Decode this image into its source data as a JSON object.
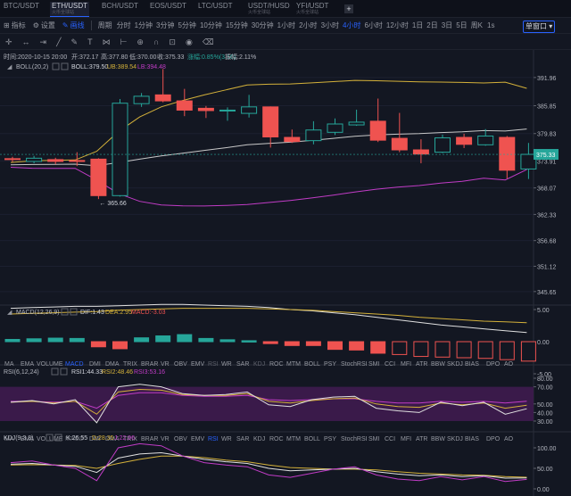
{
  "tabs": [
    {
      "pair": "BTC/USDT",
      "sub": "",
      "active": false
    },
    {
      "pair": "ETH/USDT",
      "sub": "火币全球站",
      "active": true
    },
    {
      "pair": "BCH/USDT",
      "sub": "",
      "active": false
    },
    {
      "pair": "EOS/USDT",
      "sub": "",
      "active": false
    },
    {
      "pair": "LTC/USDT",
      "sub": "",
      "active": false
    },
    {
      "pair": "USDT/HUSD",
      "sub": "火币全球站",
      "active": false
    },
    {
      "pair": "YFI/USDT",
      "sub": "火币全球站",
      "active": false
    }
  ],
  "tab_add": "+",
  "toolbar": {
    "indicator": "指标",
    "settings": "设置",
    "draw": "画线",
    "period_label": "周期",
    "periods": [
      "分时",
      "1分钟",
      "3分钟",
      "5分钟",
      "10分钟",
      "15分钟",
      "30分钟",
      "1小时",
      "2小时",
      "3小时",
      "4小时",
      "6小时",
      "12小时",
      "1日",
      "2日",
      "3日",
      "5日",
      "周K"
    ],
    "active_period": "4小时",
    "right1": "1s",
    "right2": "单窗口"
  },
  "drawing_tools": [
    "cursor-icon",
    "horizontal-line-icon",
    "ray-icon",
    "trend-line-icon",
    "pen-icon",
    "text-icon",
    "pattern-icon",
    "ruler-icon",
    "zoom-in-icon",
    "magnet-icon",
    "lock-icon",
    "eye-icon",
    "trash-icon"
  ],
  "ohlc": {
    "time": "时间:2020-10-15 20:00",
    "open": "开:372.17",
    "high": "高:377.80",
    "low": "低:370.00",
    "close": "收:375.33",
    "change": "涨幅:0.85%(3.16)",
    "amplitude": "振幅:2.11%"
  },
  "boll": {
    "label": "BOLL(20,2)",
    "mid": "BOLL:379.50",
    "ub": "UB:389.54",
    "lb": "LB:394.48"
  },
  "price_axis": [
    "391.96",
    "385.85",
    "379.83",
    "373.91",
    "368.07",
    "362.33",
    "356.68",
    "351.12",
    "345.65"
  ],
  "current_price": "375.33",
  "low_label": "← 365.66",
  "candles": [
    {
      "o": 374.4,
      "c": 374.2,
      "h": 374.8,
      "l": 373.7
    },
    {
      "o": 373.8,
      "c": 374.5,
      "h": 375.0,
      "l": 373.4
    },
    {
      "o": 374.2,
      "c": 373.8,
      "h": 374.6,
      "l": 373.2
    },
    {
      "o": 374.0,
      "c": 373.8,
      "h": 375.8,
      "l": 372.8
    },
    {
      "o": 374.3,
      "c": 366.4,
      "h": 374.5,
      "l": 365.66
    },
    {
      "o": 366.4,
      "c": 386.4,
      "h": 387.3,
      "l": 366.2
    },
    {
      "o": 386.3,
      "c": 387.9,
      "h": 388.6,
      "l": 385.6
    },
    {
      "o": 388.2,
      "c": 386.9,
      "h": 393.8,
      "l": 386.6
    },
    {
      "o": 386.9,
      "c": 384.9,
      "h": 389.5,
      "l": 383.6
    },
    {
      "o": 385.3,
      "c": 384.8,
      "h": 385.8,
      "l": 383.2
    },
    {
      "o": 384.8,
      "c": 384.9,
      "h": 385.5,
      "l": 382.6
    },
    {
      "o": 384.2,
      "c": 385.6,
      "h": 388.2,
      "l": 383.3
    },
    {
      "o": 385.6,
      "c": 379.1,
      "h": 385.7,
      "l": 376.8
    },
    {
      "o": 379.0,
      "c": 378.1,
      "h": 380.7,
      "l": 377.8
    },
    {
      "o": 378.3,
      "c": 380.6,
      "h": 382.5,
      "l": 377.5
    },
    {
      "o": 380.1,
      "c": 381.9,
      "h": 383.1,
      "l": 379.5
    },
    {
      "o": 381.7,
      "c": 382.3,
      "h": 385.0,
      "l": 381.5
    },
    {
      "o": 382.5,
      "c": 378.4,
      "h": 387.4,
      "l": 378.0
    },
    {
      "o": 378.8,
      "c": 376.3,
      "h": 384.3,
      "l": 375.8
    },
    {
      "o": 376.3,
      "c": 375.4,
      "h": 378.6,
      "l": 373.4
    },
    {
      "o": 375.8,
      "c": 378.9,
      "h": 379.6,
      "l": 375.6
    },
    {
      "o": 379.0,
      "c": 377.5,
      "h": 379.8,
      "l": 376.7
    },
    {
      "o": 377.4,
      "c": 379.3,
      "h": 380.8,
      "l": 377.2
    },
    {
      "o": 379.0,
      "c": 371.9,
      "h": 379.3,
      "l": 370.1
    },
    {
      "o": 372.17,
      "c": 375.33,
      "h": 377.8,
      "l": 370.0
    }
  ],
  "macd": {
    "label": "MACD(12,26,9)",
    "dif": "DIF:1.43",
    "dea": "DEA:2.95",
    "macd": "MACD:-3.03",
    "axis": [
      "5.00",
      "0.00",
      "-5.00"
    ],
    "hist": [
      0.35,
      0.45,
      0.55,
      0.5,
      -0.8,
      -1.1,
      0.6,
      0.9,
      1.1,
      0.5,
      0.3,
      0.15,
      -0.3,
      -0.6,
      -0.6,
      -1.2,
      -1.3,
      -1.8,
      -2.0,
      -2.3,
      -2.4,
      -2.5,
      -2.6,
      -2.8,
      -3.03
    ]
  },
  "rsi": {
    "label": "RSI(6,12,24)",
    "r1": "RSI1:44.33",
    "r2": "RSI2:48.46",
    "r3": "RSI3:53.16",
    "axis": [
      "80.00",
      "70.00",
      "50.00",
      "40.00",
      "30.00"
    ]
  },
  "kdj": {
    "label": "KDJ(9,3,3)",
    "k": "K:26.55",
    "d": "D:28.35",
    "j": "J:22.96",
    "axis": [
      "100.00",
      "50.00",
      "0.00"
    ]
  },
  "indicator_bar": [
    "MA",
    "EMA",
    "VOLUME",
    "MACD",
    "DMI",
    "DMA",
    "TRIX",
    "BRAR",
    "VR",
    "OBV",
    "EMV",
    "RSI",
    "WR",
    "SAR",
    "KDJ",
    "ROC",
    "MTM",
    "BOLL",
    "PSY",
    "StochRSI",
    "SMI",
    "CCI",
    "MFI",
    "ATR",
    "BBW",
    "SKDJ",
    "BIAS",
    "DPO",
    "AO"
  ],
  "colors": {
    "up": "#26a69a",
    "down": "#ef5350",
    "boll_mid": "#c8c8c8",
    "boll_ub": "#d4b13a",
    "boll_lb": "#c13cc6",
    "rsi_fill": "#3a1a4a",
    "accent": "#2962ff"
  }
}
